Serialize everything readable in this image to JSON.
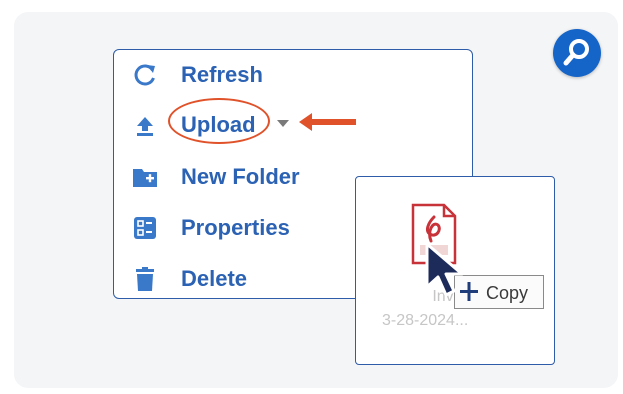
{
  "menu": {
    "items": [
      {
        "icon": "refresh-icon",
        "label": "Refresh"
      },
      {
        "icon": "upload-icon",
        "label": "Upload"
      },
      {
        "icon": "new-folder-icon",
        "label": "New Folder"
      },
      {
        "icon": "properties-icon",
        "label": "Properties"
      },
      {
        "icon": "delete-icon",
        "label": "Delete"
      }
    ]
  },
  "drag": {
    "file_icon": "pdf-file-icon",
    "file_name_line1": "Inv",
    "file_name_line2": "3-28-2024...",
    "tooltip_label": "Copy"
  },
  "colors": {
    "accent": "#2b62b3",
    "highlight": "#e0522a",
    "pdf_red": "#c8333a",
    "badge": "#1565c9"
  }
}
